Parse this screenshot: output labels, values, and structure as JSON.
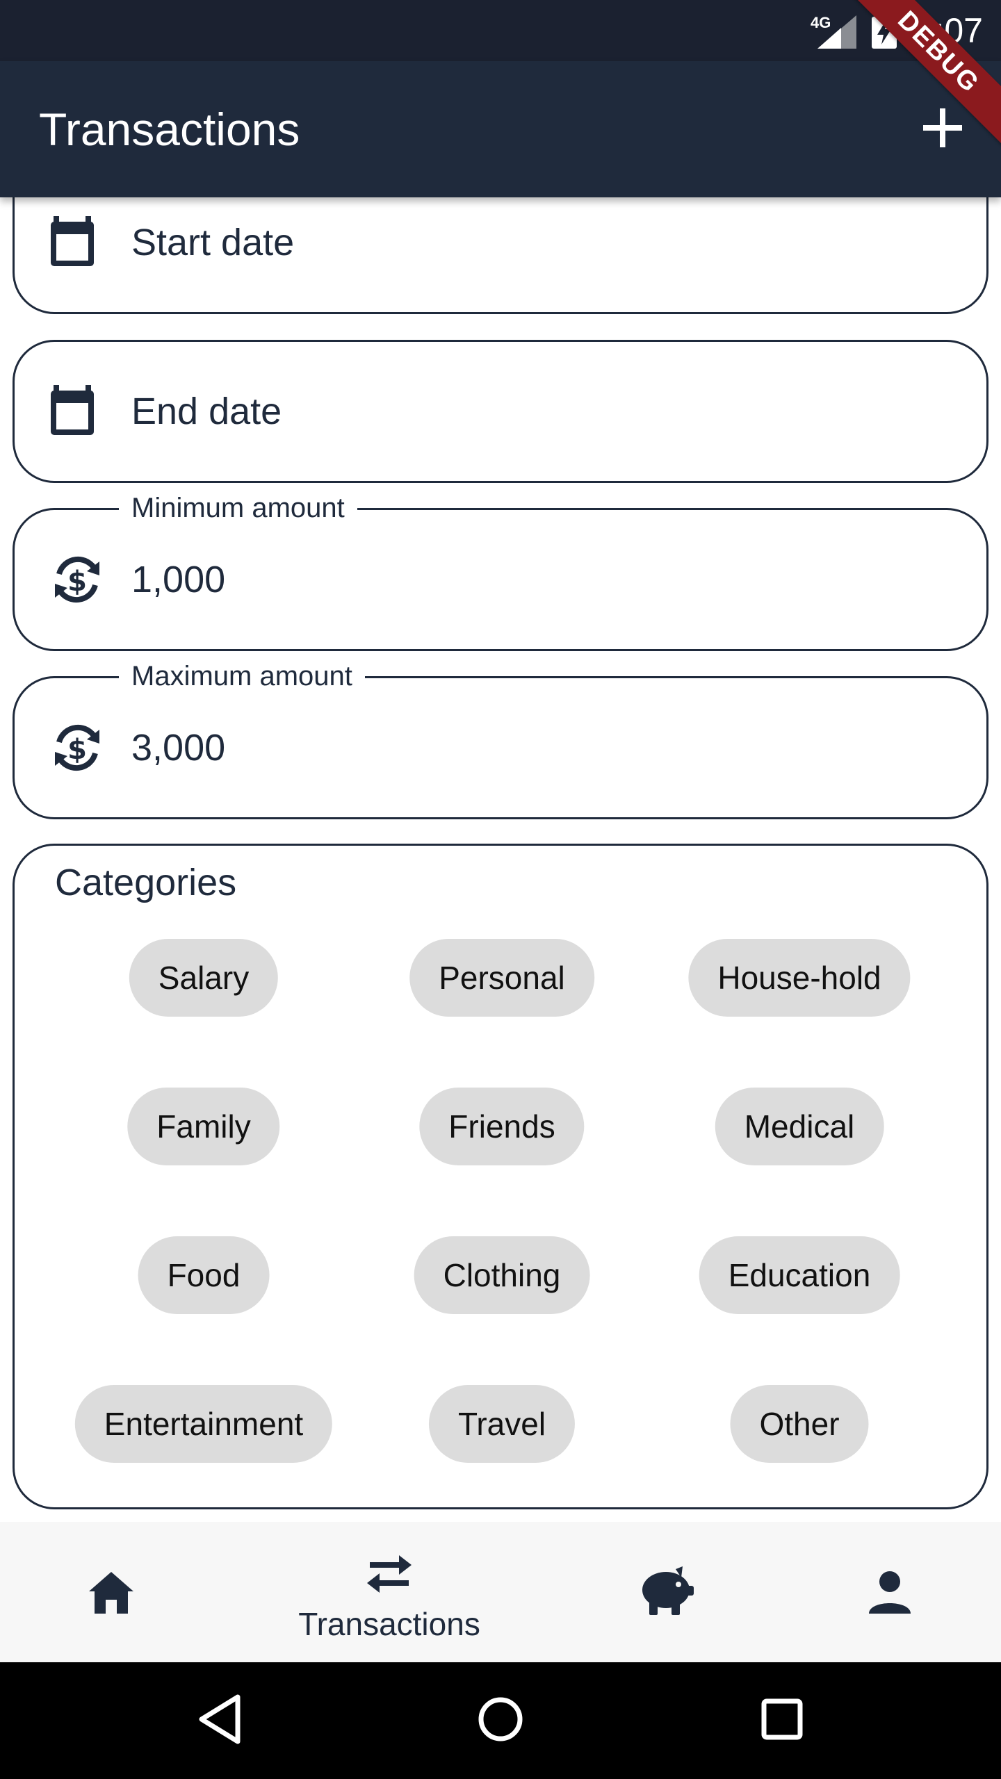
{
  "status_bar": {
    "time": "7:07",
    "network": "4G"
  },
  "debug_banner": "DEBUG",
  "app_bar": {
    "title": "Transactions",
    "action_icon": "add-icon"
  },
  "filters": {
    "start_date": {
      "placeholder": "Start date",
      "icon": "calendar-icon"
    },
    "end_date": {
      "placeholder": "End date",
      "icon": "calendar-icon"
    },
    "min_amount": {
      "label": "Minimum amount",
      "value": "1,000",
      "icon": "currency-exchange-icon"
    },
    "max_amount": {
      "label": "Maximum amount",
      "value": "3,000",
      "icon": "currency-exchange-icon"
    }
  },
  "categories": {
    "title": "Categories",
    "items": [
      "Salary",
      "Personal",
      "House-hold",
      "Family",
      "Friends",
      "Medical",
      "Food",
      "Clothing",
      "Education",
      "Entertainment",
      "Travel",
      "Other"
    ]
  },
  "bottom_nav": {
    "items": [
      {
        "icon": "home-icon",
        "label": ""
      },
      {
        "icon": "transfer-arrows-icon",
        "label": "Transactions"
      },
      {
        "icon": "piggy-bank-icon",
        "label": ""
      },
      {
        "icon": "person-icon",
        "label": ""
      }
    ],
    "active_index": 1
  },
  "colors": {
    "app_bar": "#1f2a3c",
    "status_bar": "#1b2130",
    "chip_bg": "#dcdcdc",
    "debug_banner": "#8b1a1e"
  }
}
